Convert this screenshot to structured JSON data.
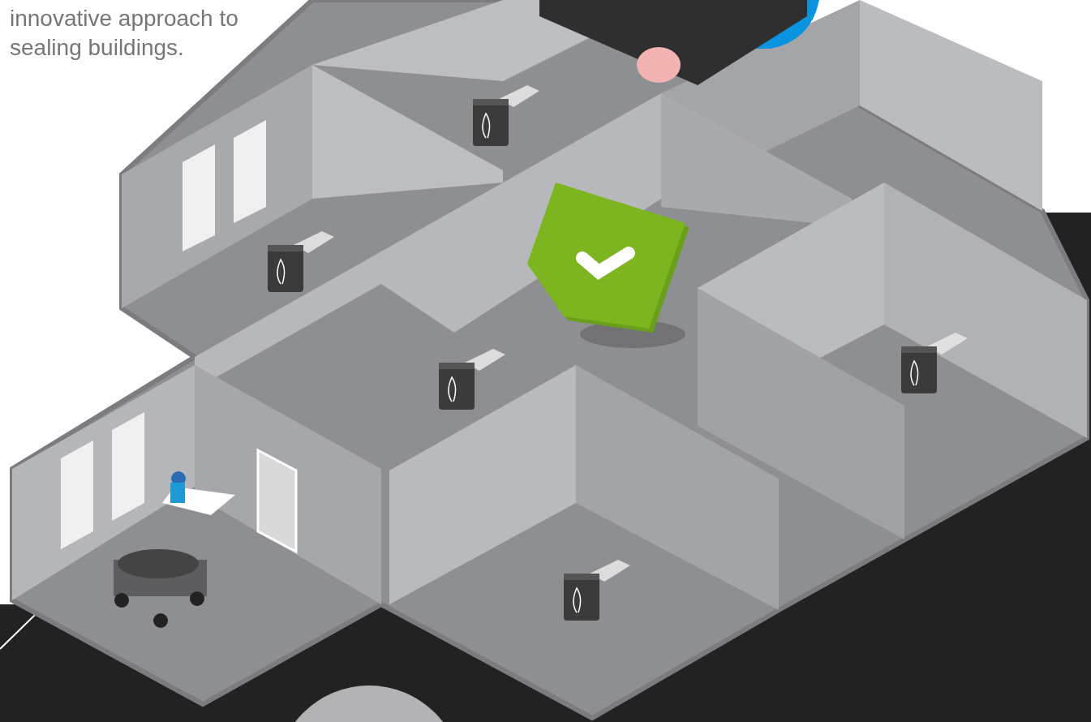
{
  "intro": {
    "lines": [
      "innovative approach to",
      "sealing buildings."
    ]
  }
}
